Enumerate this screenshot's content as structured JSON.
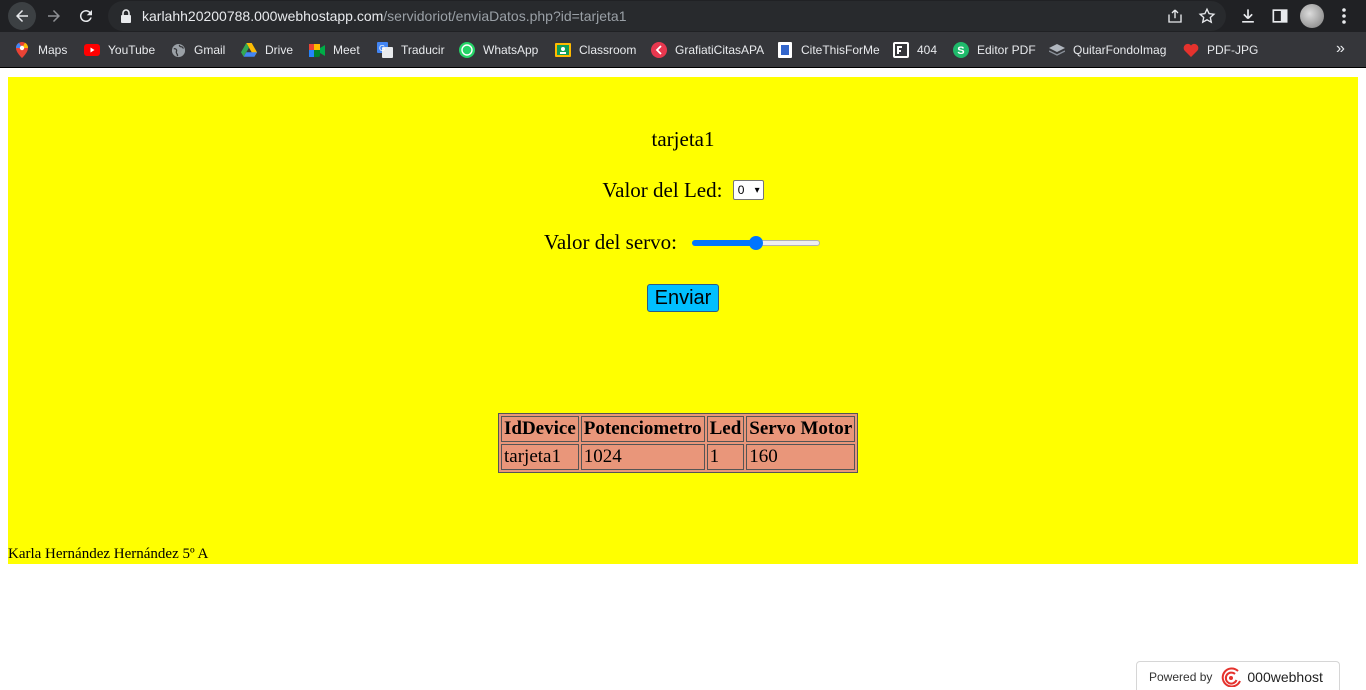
{
  "browser": {
    "url_host": "karlahh20200788.000webhostapp.com",
    "url_path": "/servidoriot/enviaDatos.php?id=tarjeta1",
    "bookmarks": [
      {
        "label": "Maps",
        "icon": "maps-pin-icon"
      },
      {
        "label": "YouTube",
        "icon": "youtube-icon"
      },
      {
        "label": "Gmail",
        "icon": "globe-icon"
      },
      {
        "label": "Drive",
        "icon": "drive-icon"
      },
      {
        "label": "Meet",
        "icon": "meet-icon"
      },
      {
        "label": "Traducir",
        "icon": "translate-icon"
      },
      {
        "label": "WhatsApp",
        "icon": "whatsapp-icon"
      },
      {
        "label": "Classroom",
        "icon": "classroom-icon"
      },
      {
        "label": "GrafiatiCitasAPA",
        "icon": "grafiati-icon"
      },
      {
        "label": "CiteThisForMe",
        "icon": "citethisforme-icon"
      },
      {
        "label": "404",
        "icon": "404-icon"
      },
      {
        "label": "Editor PDF",
        "icon": "editor-pdf-icon"
      },
      {
        "label": "QuitarFondoImag",
        "icon": "layers-icon"
      },
      {
        "label": "PDF-JPG",
        "icon": "heart-icon"
      }
    ],
    "overflow_glyph": "»"
  },
  "page": {
    "device_id": "tarjeta1",
    "led_label": "Valor del Led:",
    "led_value": "0",
    "servo_label": "Valor del servo:",
    "servo_fraction": 0.5,
    "send_label": "Enviar",
    "table": {
      "headers": [
        "IdDevice",
        "Potenciometro",
        "Led",
        "Servo Motor"
      ],
      "rows": [
        [
          "tarjeta1",
          "1024",
          "1",
          "160"
        ]
      ]
    },
    "footer": "Karla Hernández Hernández 5º A"
  },
  "hosting_badge": {
    "powered_label": "Powered by",
    "brand": "000webhost"
  },
  "colors": {
    "page_background": "#ffff00",
    "button": "#00bfff",
    "table_cells": "#e9967a",
    "slider_accent": "#0075ff",
    "browser_chrome": "#202124"
  }
}
